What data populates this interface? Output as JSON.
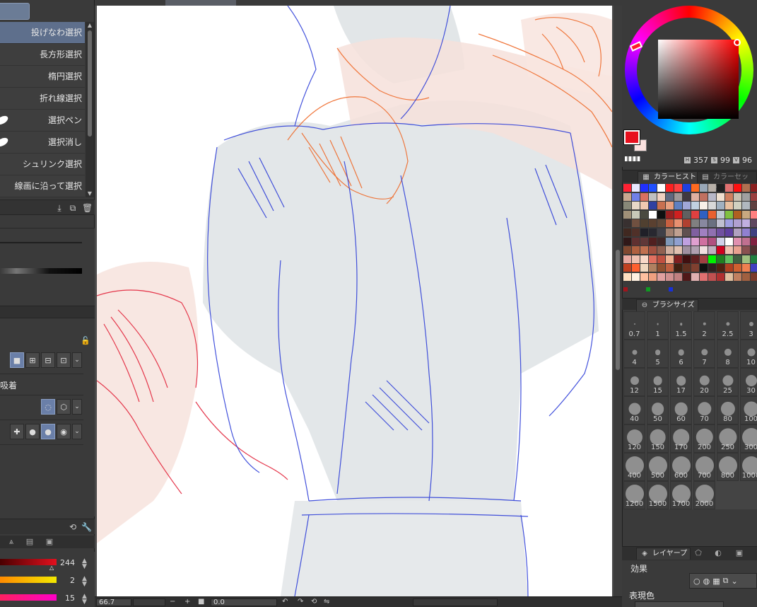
{
  "tools": {
    "items": [
      {
        "label": "投げなわ選択",
        "active": true
      },
      {
        "label": "長方形選択"
      },
      {
        "label": "楕円選択"
      },
      {
        "label": "折れ線選択"
      },
      {
        "label": "選択ペン"
      },
      {
        "label": "選択消し"
      },
      {
        "label": "シュリンク選択"
      },
      {
        "label": "線画に沿って選択"
      }
    ]
  },
  "tool_property": {
    "snap_label": "吸着"
  },
  "color_sliders": [
    {
      "value": "244",
      "color": "#e2101e"
    },
    {
      "value": "2",
      "color": "#f2e800"
    },
    {
      "value": "15",
      "color": "#ff00c8"
    }
  ],
  "status": {
    "zoom": "66.7",
    "rotation": "0.0"
  },
  "color_wheel": {
    "main_color": "#e8101e",
    "sub_color": "#fbe1df",
    "h": "357",
    "s": "99",
    "v": "96"
  },
  "palette_tabs": {
    "history": "カラーヒストリー",
    "set": "カラーセット"
  },
  "brush_panel": {
    "tab": "ブラシサイズ",
    "sizes": [
      "0.7",
      "1",
      "1.5",
      "2",
      "2.5",
      "3",
      "4",
      "5",
      "6",
      "7",
      "8",
      "10",
      "12",
      "15",
      "17",
      "20",
      "25",
      "30",
      "40",
      "50",
      "60",
      "70",
      "80",
      "100",
      "120",
      "150",
      "170",
      "200",
      "250",
      "300",
      "400",
      "500",
      "600",
      "700",
      "800",
      "1000",
      "1200",
      "1500",
      "1700",
      "2000"
    ]
  },
  "layer_panel": {
    "tab": "レイヤープ",
    "effect_label": "効果",
    "express_label": "表現色"
  }
}
